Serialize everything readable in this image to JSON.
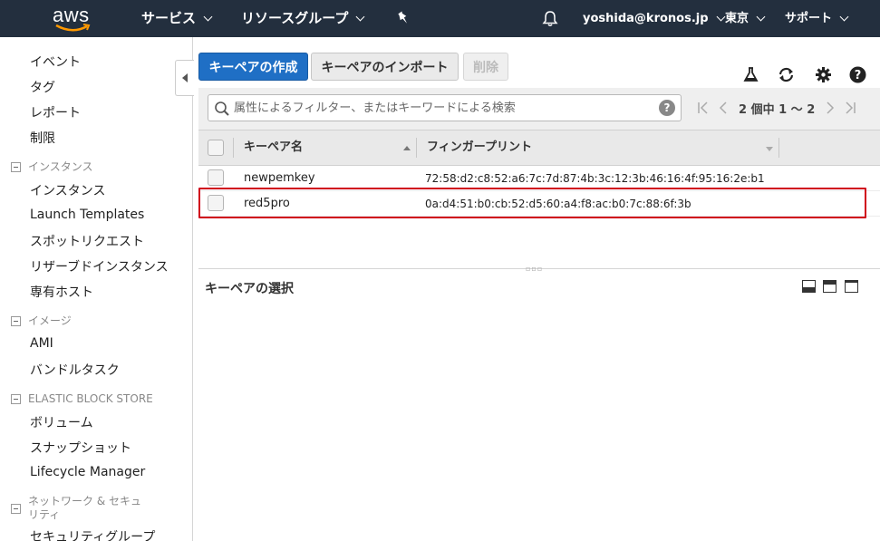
{
  "topnav": {
    "logo": "aws",
    "services": "サービス",
    "resource_groups": "リソースグループ",
    "user": "yoshida@kronos.jp",
    "region": "東京",
    "support": "サポート"
  },
  "sidebar": {
    "top_links": [
      "イベント",
      "タグ",
      "レポート",
      "制限"
    ],
    "sections": [
      {
        "title": "インスタンス",
        "items": [
          "インスタンス",
          "Launch Templates",
          "スポットリクエスト",
          "リザーブドインスタンス",
          "専有ホスト"
        ]
      },
      {
        "title": "イメージ",
        "items": [
          "AMI",
          "バンドルタスク"
        ]
      },
      {
        "title": "ELASTIC BLOCK STORE",
        "items": [
          "ボリューム",
          "スナップショット",
          "Lifecycle Manager"
        ]
      },
      {
        "title": "ネットワーク & セキュリティ",
        "items": [
          "セキュリティグループ"
        ]
      }
    ]
  },
  "toolbar": {
    "create_label": "キーペアの作成",
    "import_label": "キーペアのインポート",
    "delete_label": "削除"
  },
  "search": {
    "placeholder": "属性によるフィルター、またはキーワードによる検索",
    "help": "?"
  },
  "pager": {
    "text": "2 個中 1 〜 2"
  },
  "table": {
    "columns": [
      "キーペア名",
      "フィンガープリント"
    ],
    "rows": [
      {
        "name": "newpemkey",
        "fingerprint": "72:58:d2:c8:52:a6:7c:7d:87:4b:3c:12:3b:46:16:4f:95:16:2e:b1"
      },
      {
        "name": "red5pro",
        "fingerprint": "0a:d4:51:b0:cb:52:d5:60:a4:f8:ac:b0:7c:88:6f:3b"
      }
    ]
  },
  "detail": {
    "title": "キーペアの選択"
  },
  "colors": {
    "nav_bg": "#232f3e",
    "primary": "#1f6fc5",
    "highlight": "#d0021b"
  }
}
